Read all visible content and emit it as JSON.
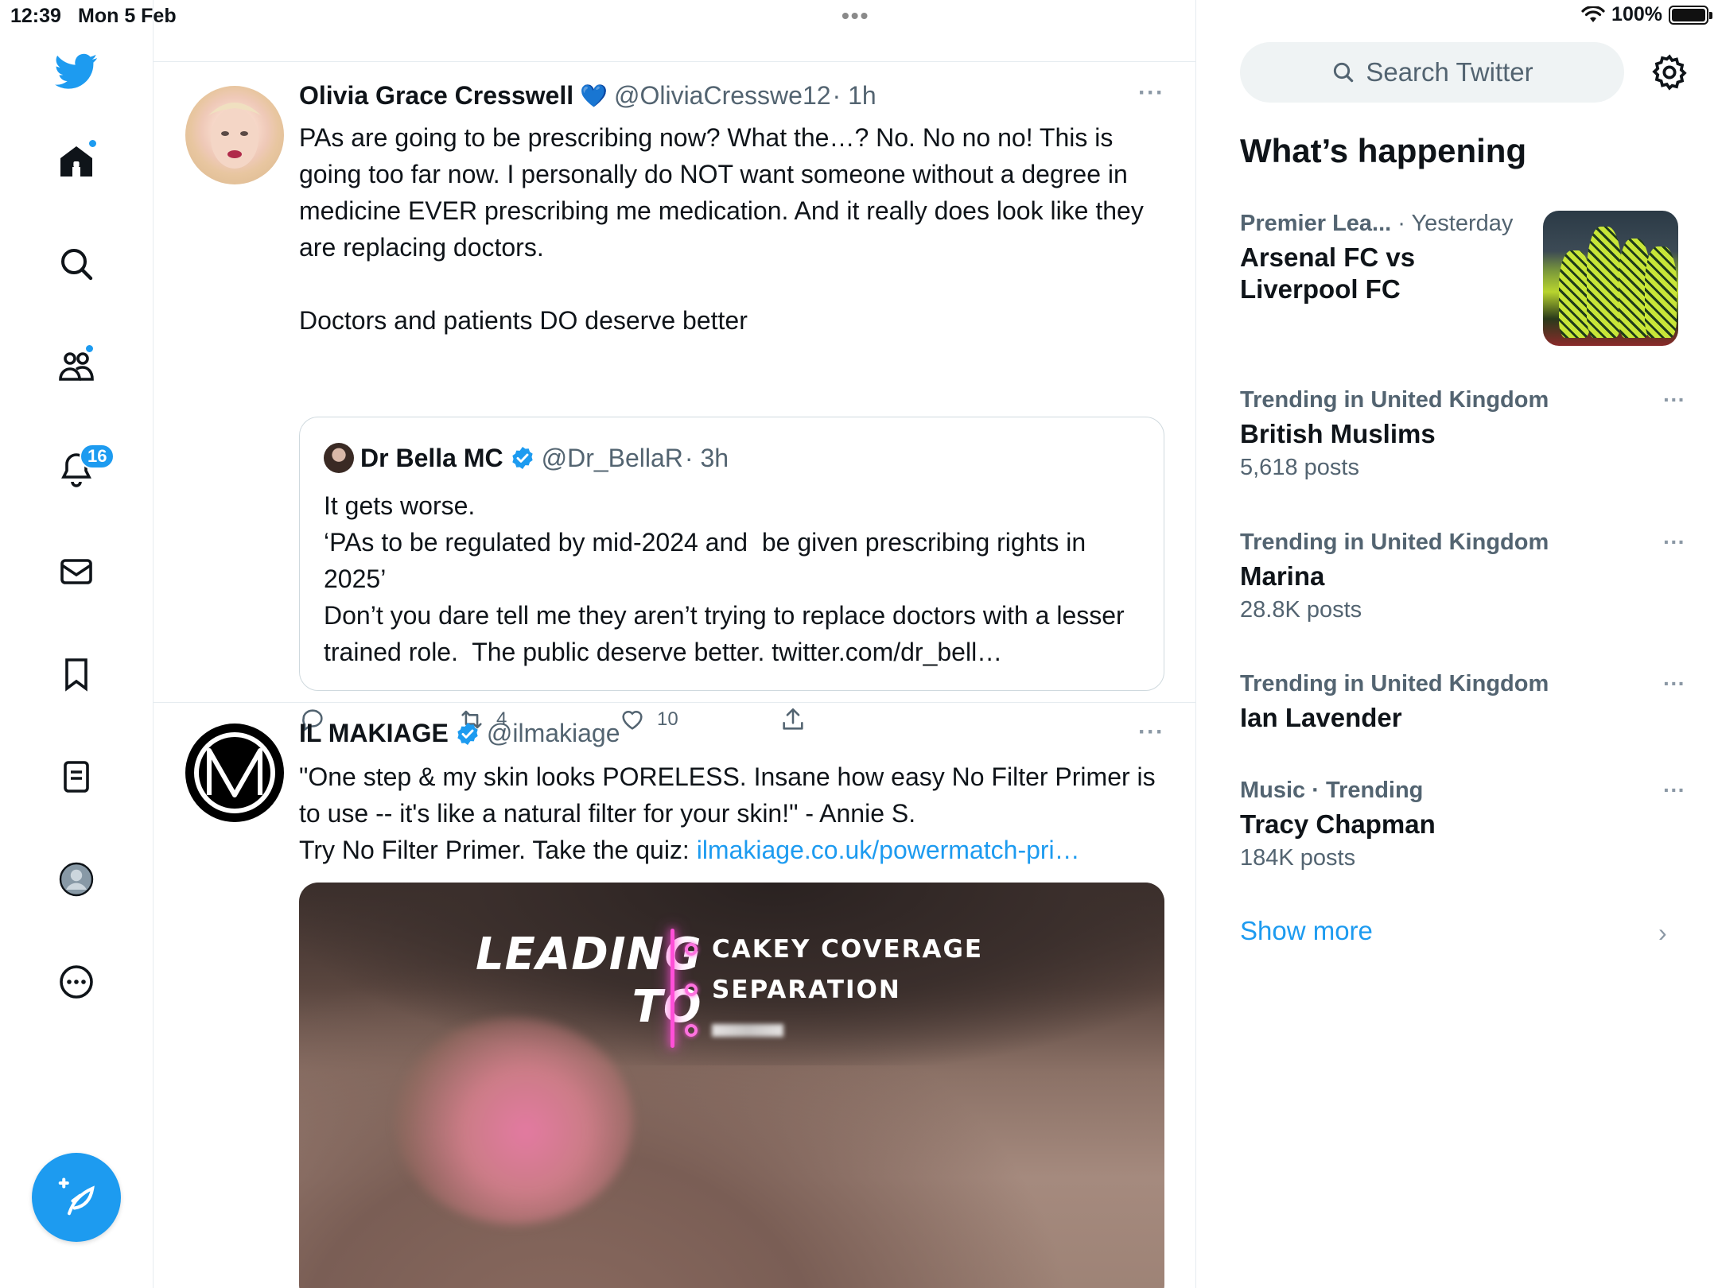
{
  "status_bar": {
    "time": "12:39",
    "date": "Mon 5 Feb",
    "battery": "100%",
    "battery_level": 1.0
  },
  "nav": {
    "items": [
      "twitter-logo",
      "home",
      "search",
      "communities",
      "notifications",
      "messages",
      "bookmarks",
      "lists",
      "profile",
      "more"
    ],
    "notifications_badge": "16"
  },
  "tweets": [
    {
      "name": "Olivia Grace Cresswell",
      "verified_emoji": "💙",
      "handle": "@OliviaCresswe12",
      "time": "· 1h",
      "more": "···",
      "text": "PAs are going to be prescribing now? What the…? No. No no no! This is going too far now. I personally do NOT want someone without a degree in medicine EVER prescribing me medication. And it really does look like they are replacing doctors.\n\nDoctors and patients DO deserve better",
      "quote": {
        "name": "Dr Bella MC",
        "handle": "@Dr_BellaR",
        "time": "· 3h",
        "text": "It gets worse.\n‘PAs to be regulated by mid-2024 and  be given prescribing rights in 2025’\nDon’t you dare tell me they aren’t trying to replace doctors with a lesser trained role.  The public deserve better. twitter.com/dr_bell…"
      },
      "actions": {
        "replies": "",
        "retweets": "4",
        "likes": "10"
      }
    },
    {
      "name": "IL MAKIAGE",
      "handle": "@ilmakiage",
      "more": "···",
      "text_main": "\"One step & my skin looks PORELESS. Insane how easy No Filter Primer is to use -- it's like a natural filter for your skin!\" - Annie S.\nTry No Filter Primer. Take the quiz: ",
      "link": "ilmakiage.co.uk/powermatch-pri…",
      "media": {
        "leading": "LEADING",
        "to": "TO",
        "bullets": [
          "CAKEY COVERAGE",
          "SEPARATION"
        ]
      }
    }
  ],
  "sidebar": {
    "search_placeholder": "Search Twitter",
    "whats_happening": "What’s happening",
    "trends": [
      {
        "category": "Premier Lea...",
        "time": "· Yesterday",
        "title": "Arsenal FC vs Liverpool FC",
        "count": "",
        "has_image": true
      },
      {
        "category": "Trending in United Kingdom",
        "title": "British Muslims",
        "count": "5,618 posts"
      },
      {
        "category": "Trending in United Kingdom",
        "title": "Marina",
        "count": "28.8K posts"
      },
      {
        "category": "Trending in United Kingdom",
        "title": "Ian Lavender",
        "count": ""
      },
      {
        "category": "Music · Trending",
        "title": "Tracy Chapman",
        "count": "184K posts"
      }
    ],
    "show_more": "Show more",
    "trend_more": "···"
  },
  "colors": {
    "accent": "#1d9bf0",
    "text": "#0f1419",
    "secondary": "#536471",
    "border": "#e6ecf0"
  }
}
